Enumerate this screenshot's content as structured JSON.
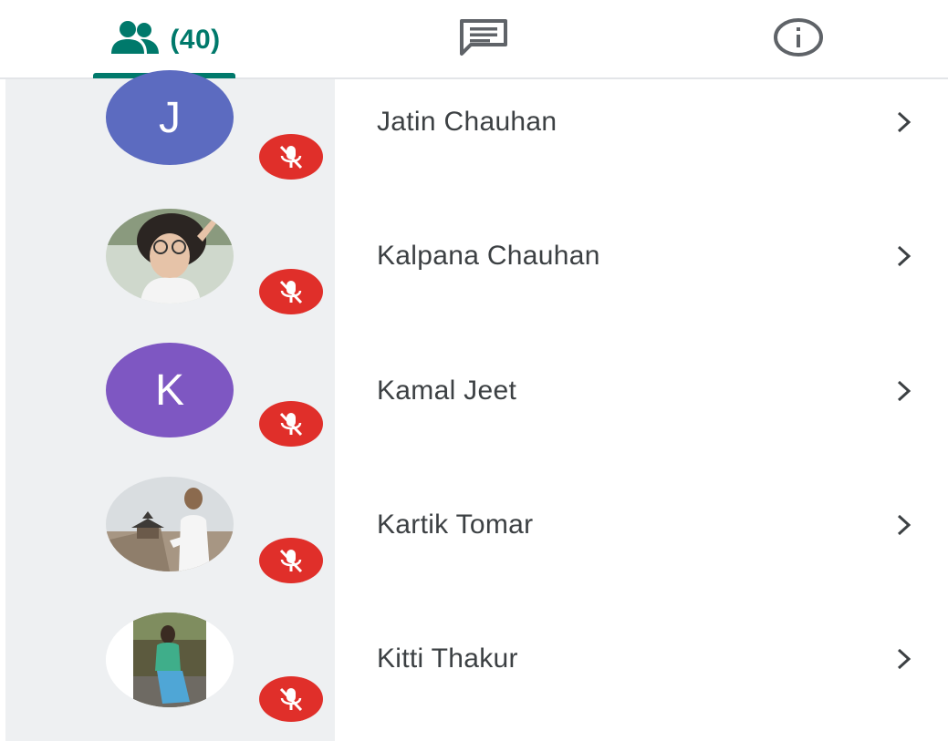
{
  "tabs": {
    "people": {
      "icon": "people-icon",
      "count_label": "(40)"
    },
    "chat": {
      "icon": "chat-icon"
    },
    "info": {
      "icon": "info-icon"
    }
  },
  "accent_color": "#00796b",
  "mute_color": "#e02f2a",
  "participants": [
    {
      "name": "Jatin Chauhan",
      "avatar_letter": "J",
      "avatar_color": "#5c6bc0",
      "muted": true
    },
    {
      "name": "Kalpana Chauhan",
      "avatar_photo": true,
      "muted": true
    },
    {
      "name": "Kamal Jeet",
      "avatar_letter": "K",
      "avatar_color": "#7e57c2",
      "muted": true
    },
    {
      "name": "Kartik Tomar",
      "avatar_photo": true,
      "muted": true
    },
    {
      "name": "Kitti Thakur",
      "avatar_photo": true,
      "muted": true
    }
  ]
}
